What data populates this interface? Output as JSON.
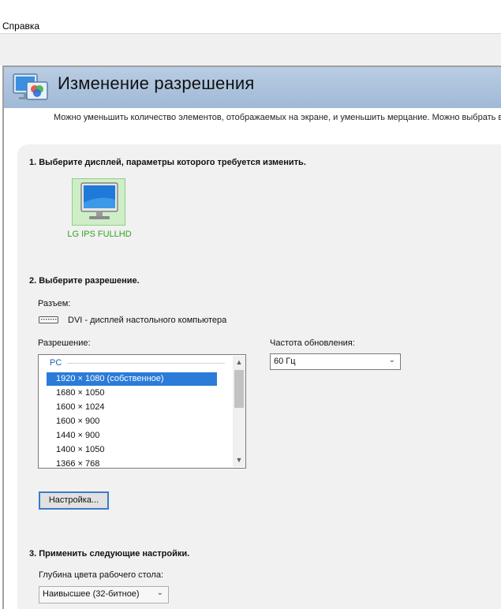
{
  "menu": {
    "help": "Справка"
  },
  "header": {
    "title": "Изменение разрешения",
    "description": "Можно уменьшить количество элементов, отображаемых на экране, и уменьшить мерцание. Можно выбрать в"
  },
  "step1": {
    "title": "1. Выберите дисплей, параметры которого требуется изменить.",
    "display_name": "LG IPS FULLHD"
  },
  "step2": {
    "title": "2. Выберите разрешение.",
    "connector_label": "Разъем:",
    "connector_value": "DVI - дисплей настольного компьютера",
    "resolution_label": "Разрешение:",
    "resolution_group": "PC",
    "resolutions": [
      "1920 × 1080 (собственное)",
      "1680 × 1050",
      "1600 × 1024",
      "1600 × 900",
      "1440 × 900",
      "1400 × 1050",
      "1366 × 768"
    ],
    "selected_index": 0,
    "refresh_label": "Частота обновления:",
    "refresh_value": "60 Гц",
    "customize_button": "Настройка..."
  },
  "step3": {
    "title": "3. Применить следующие настройки.",
    "color_depth_label": "Глубина цвета рабочего стола:",
    "color_depth_value": "Наивысшее (32-битное)"
  },
  "colors": {
    "banner": "#9fb9d6",
    "selection": "#2b7bd8",
    "display_name": "#2ea323",
    "group_label": "#1e5fae"
  }
}
